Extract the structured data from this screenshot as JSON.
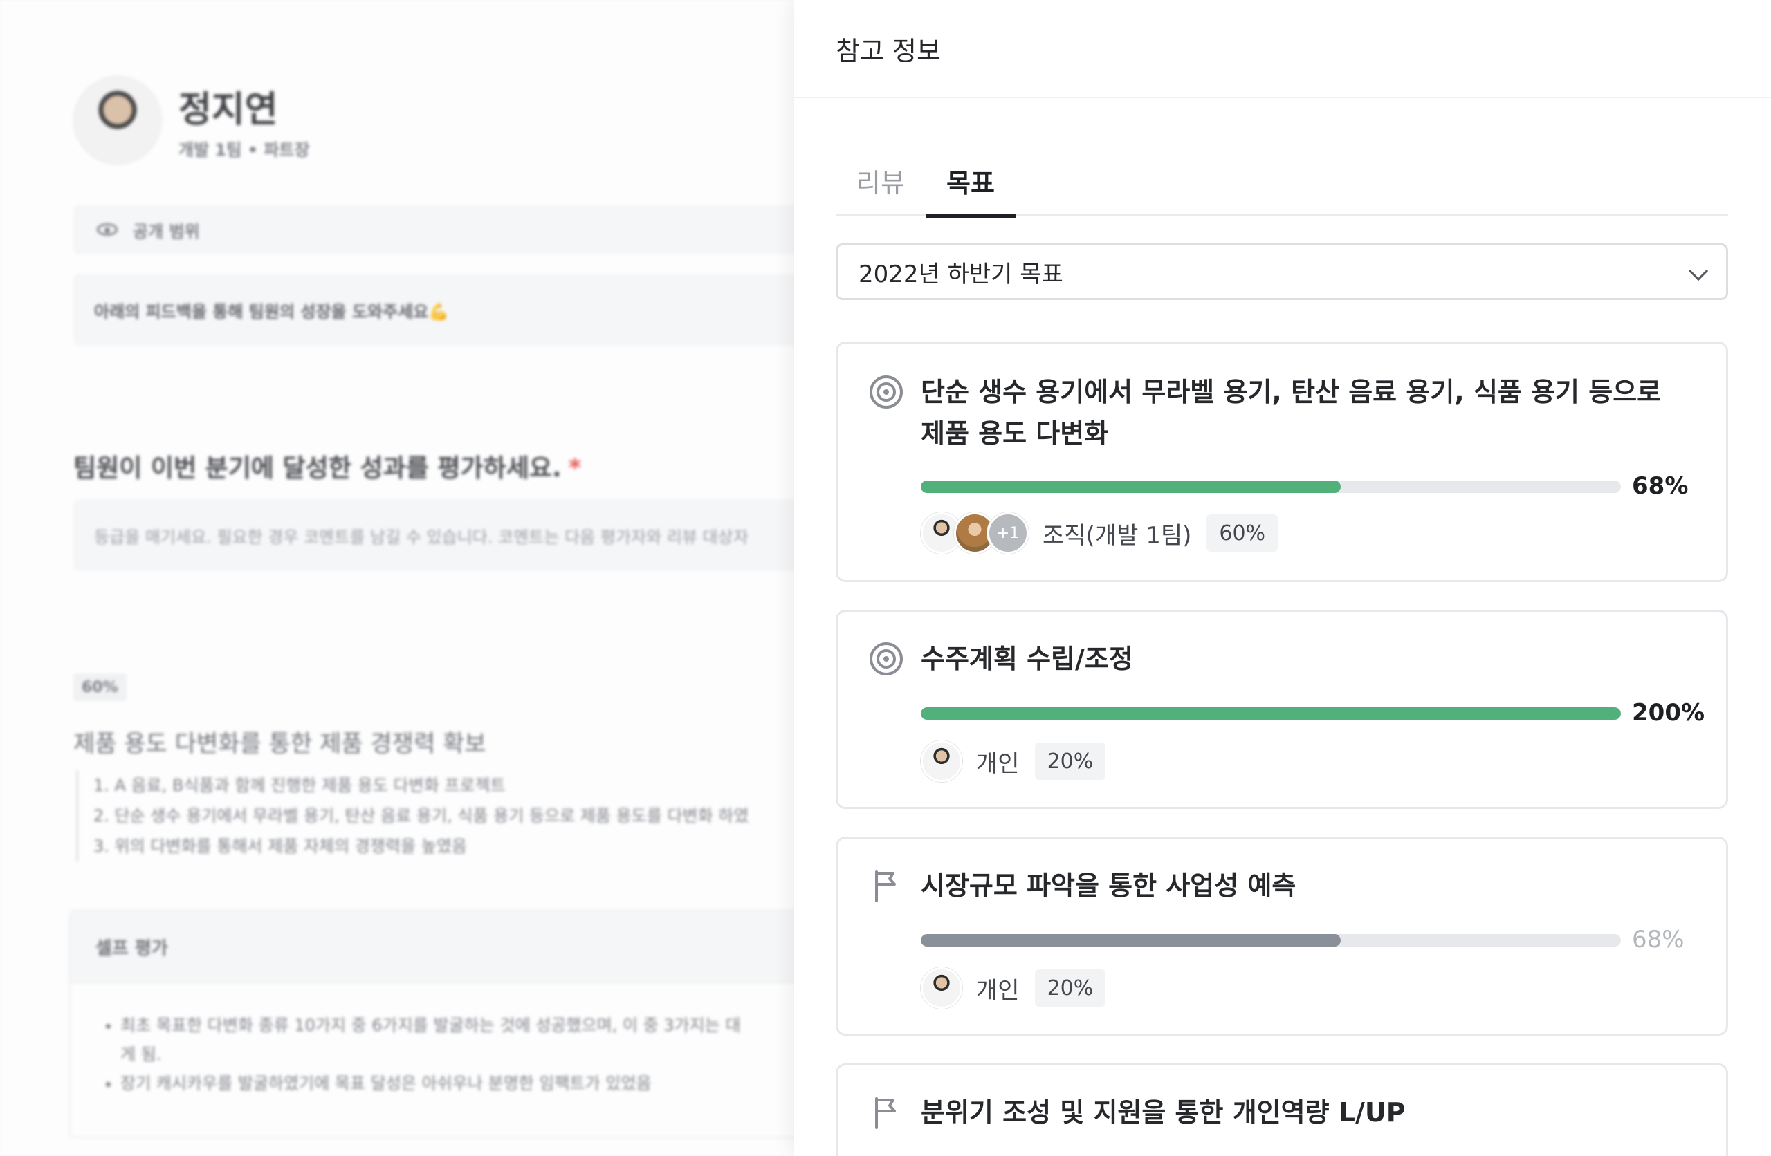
{
  "left_page": {
    "profile": {
      "name": "정지연",
      "role": "개발 1팀 • 파트장"
    },
    "scope_label": "공개 범위",
    "hint": "아래의 피드백을 통해 팀원의 성장을 도와주세요💪",
    "question": "팀원이 이번 분기에 달성한 성과를 평가하세요.",
    "required_mark": "*",
    "grade_placeholder": "등급을 매기세요. 필요한 경우 코멘트를 남길 수 있습니다. 코멘트는 다음 평가자와 리뷰 대상자",
    "goal_percent": "60%",
    "goal_title": "제품 용도 다변화를 통한 제품 경쟁력 확보",
    "goal_steps": [
      "1. A 음료, B식품과 함께 진행한 제품 용도 다변화 프로젝트",
      "2. 단순 생수 용기에서 무라벨 용기, 탄산 음료 용기, 식품 용기 등으로 제품 용도를 다변화 하였",
      "3. 위의 다변화를 통해서 제품 자체의 경쟁력을 높였음"
    ],
    "self_eval": {
      "title": "셀프 평가",
      "items": [
        "최초 목표한 다변화 종류 10가지 중 6가지를 발굴하는 것에 성공했으며, 이 중 3가지는 대",
        "게 됨.",
        "장기 캐시카우를 발굴하였기에 목표 달성은 아쉬우나 분명한 임팩트가 있었음"
      ]
    }
  },
  "panel": {
    "title": "참고 정보",
    "tabs": [
      {
        "label": "리뷰",
        "active": false
      },
      {
        "label": "목표",
        "active": true
      }
    ],
    "period_select": "2022년 하반기 목표",
    "colors": {
      "progress_green": "#52b07a",
      "progress_gray": "#8a9099",
      "track": "#e6e8eb"
    },
    "goals": [
      {
        "icon": "target-icon",
        "title": "단순 생수 용기에서 무라벨 용기, 탄산 음료 용기, 식품 용기 등으로 제품 용도 다변화",
        "progress": 0.6,
        "progress_label": "68%",
        "color": "#52b07a",
        "owner_label": "조직(개발 1팀)",
        "extra_members": "+1",
        "weight": "60%"
      },
      {
        "icon": "target-icon",
        "title": "수주계획 수립/조정",
        "progress": 1.0,
        "progress_label": "200%",
        "color": "#52b07a",
        "owner_label": "개인",
        "weight": "20%"
      },
      {
        "icon": "flag-icon",
        "title": "시장규모 파악을 통한 사업성 예측",
        "progress": 0.6,
        "progress_label": "68%",
        "color": "#8a9099",
        "owner_label": "개인",
        "weight": "20%"
      },
      {
        "icon": "flag-icon",
        "title": "분위기 조성 및 지원을 통한 개인역량 L/UP"
      }
    ]
  }
}
